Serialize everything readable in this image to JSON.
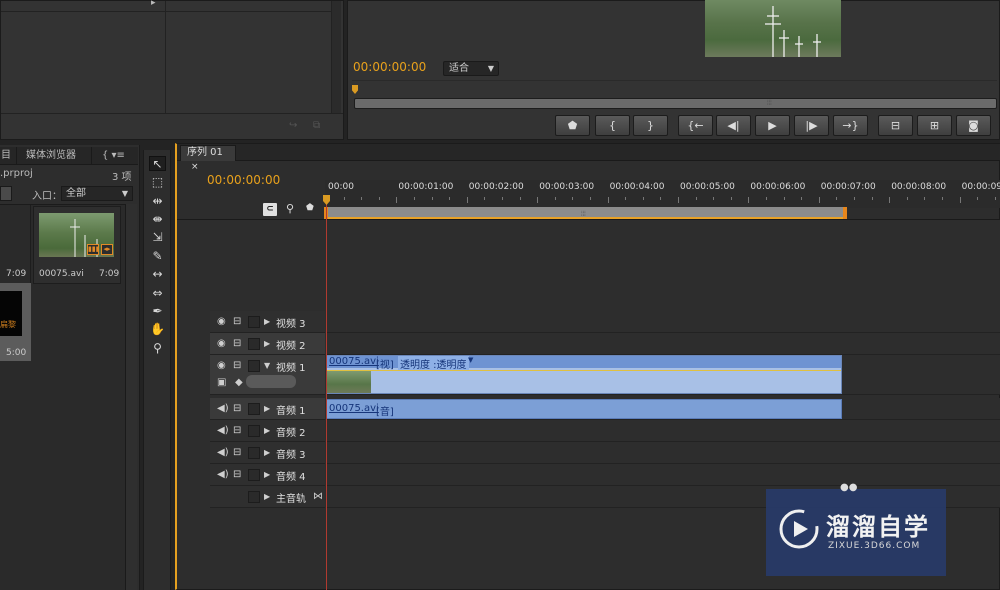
{
  "program_monitor": {
    "timecode": "00:00:00:00",
    "fit_select": "适合",
    "controls": [
      {
        "name": "marker-button",
        "glyph": "⬟"
      },
      {
        "name": "mark-in-button",
        "glyph": "{"
      },
      {
        "name": "mark-out-button",
        "glyph": "}"
      },
      {
        "name": "go-to-in-button",
        "glyph": "{←"
      },
      {
        "name": "step-back-button",
        "glyph": "◀|"
      },
      {
        "name": "play-button",
        "glyph": "▶"
      },
      {
        "name": "step-forward-button",
        "glyph": "|▶"
      },
      {
        "name": "go-to-out-button",
        "glyph": "→}"
      },
      {
        "name": "lift-button",
        "glyph": "⊟"
      },
      {
        "name": "extract-button",
        "glyph": "⊞"
      },
      {
        "name": "export-frame-button",
        "glyph": "◙"
      }
    ]
  },
  "project": {
    "tabs": [
      "目",
      "媒体浏览器",
      "{ ▾≡"
    ],
    "file_name": ".prproj",
    "item_count": "3 项",
    "entry_label": "入口：",
    "entry_value": "全部",
    "items": [
      {
        "name": "00075.avi",
        "duration": "7:09"
      },
      {
        "duration_left": "7:09"
      },
      {
        "label": "扁黎",
        "duration": "5:00"
      }
    ]
  },
  "timeline": {
    "tab": "序列 01",
    "tab_close": "×",
    "timecode": "00:00:00:00",
    "ruler": [
      "00:00",
      "00:00:01:00",
      "00:00:02:00",
      "00:00:03:00",
      "00:00:04:00",
      "00:00:05:00",
      "00:00:06:00",
      "00:00:07:00",
      "00:00:08:00",
      "00:00:09:00"
    ],
    "tracks": {
      "v3": "视频 3",
      "v2": "视频 2",
      "v1": "视频 1",
      "a1": "音频 1",
      "a2": "音频 2",
      "a3": "音频 3",
      "a4": "音频 4",
      "master": "主音轨"
    },
    "v1_clip": {
      "name": "00075.avi",
      "tag": "[视]",
      "effect": "透明度 :透明度"
    },
    "a1_clip": {
      "name": "00075.avi",
      "tag": "[音]"
    }
  },
  "watermark": {
    "title": "溜溜自学",
    "subtitle": "ZIXUE.3D66.COM"
  },
  "colors": {
    "accent": "#e8a11c",
    "clip_video": "#a8c0e6",
    "clip_audio": "#7c9fd6",
    "playhead": "#b03a30"
  }
}
